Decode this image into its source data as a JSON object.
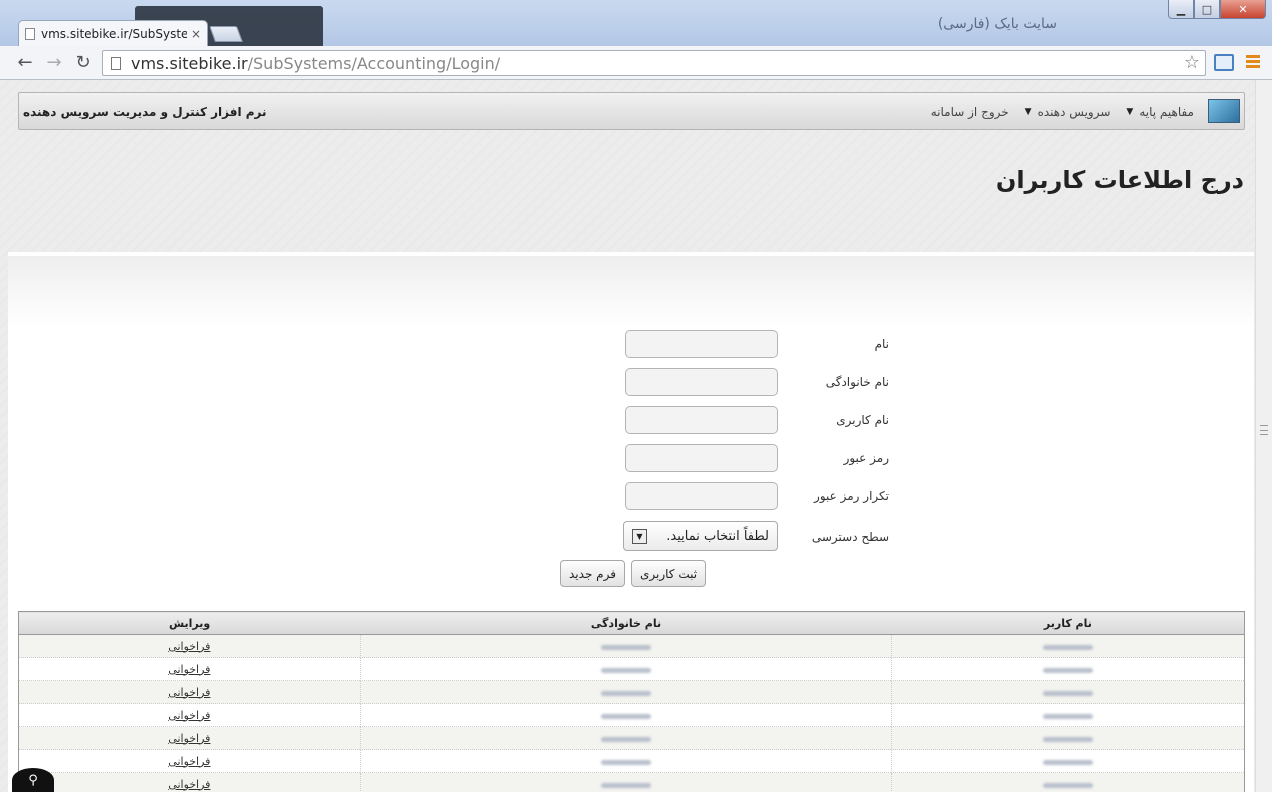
{
  "window": {
    "ghost_title": "سایت بایک (فارسی)",
    "minimize": "▁",
    "maximize": "□",
    "close": "✕"
  },
  "tab": {
    "title": "vms.sitebike.ir/SubSystem",
    "close": "×"
  },
  "toolbar": {
    "back": "←",
    "forward": "→",
    "reload": "↻",
    "url_host": "vms.sitebike.ir",
    "url_path": "/SubSystems/Accounting/Login/",
    "star": "☆"
  },
  "topnav": {
    "items": [
      {
        "label": "مفاهیم پایه",
        "caret": "▼"
      },
      {
        "label": "سرویس دهنده",
        "caret": "▼"
      },
      {
        "label": "خروج از سامانه"
      }
    ],
    "brand": "نرم افزار کنترل و مدیریت سرویس دهنده"
  },
  "page_title": "درج اطلاعات کاربران",
  "form": {
    "first_name_label": "نام",
    "last_name_label": "نام خانوادگی",
    "username_label": "نام کاربری",
    "password_label": "رمز عبور",
    "password_repeat_label": "تکرار رمز عبور",
    "access_level_label": "سطح دسترسی",
    "access_level_selected": "لطفاً انتخاب نمایید.",
    "submit_label": "ثبت کاربری",
    "new_form_label": "فرم جدید"
  },
  "table": {
    "headers": [
      "نام کاربر",
      "نام خانوادگی",
      "ویرایش"
    ],
    "rows": [
      {
        "edit": "فراخوانی"
      },
      {
        "edit": "فراخوانی"
      },
      {
        "edit": "فراخوانی"
      },
      {
        "edit": "فراخوانی"
      },
      {
        "edit": "فراخوانی"
      },
      {
        "edit": "فراخوانی"
      },
      {
        "edit": "فراخوانی"
      }
    ]
  }
}
